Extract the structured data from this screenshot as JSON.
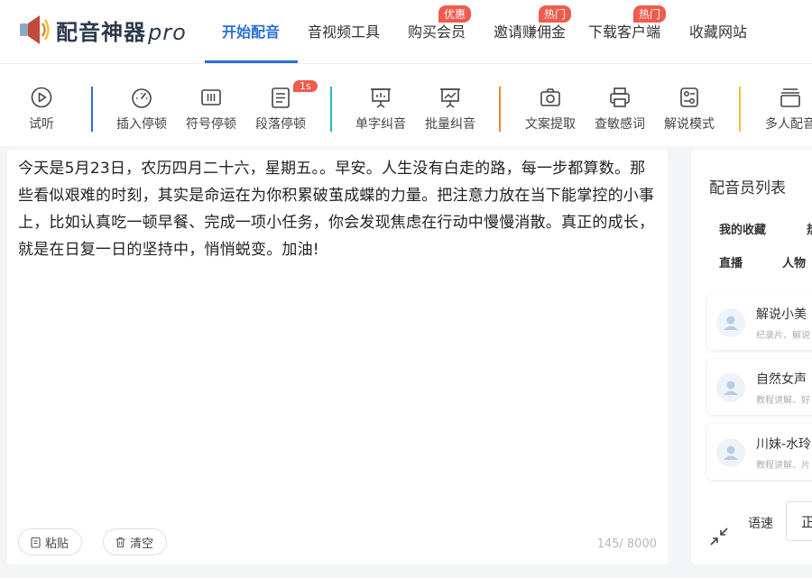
{
  "app": {
    "name": "配音神器",
    "name_suffix": "pro"
  },
  "nav": {
    "items": [
      {
        "label": "开始配音",
        "badge": ""
      },
      {
        "label": "音视频工具",
        "badge": ""
      },
      {
        "label": "购买会员",
        "badge": "优惠"
      },
      {
        "label": "邀请赚佣金",
        "badge": "热门"
      },
      {
        "label": "下载客户端",
        "badge": "热门"
      },
      {
        "label": "收藏网站",
        "badge": ""
      }
    ]
  },
  "toolbar": {
    "items": [
      {
        "label": "试听",
        "icon": "play-icon"
      },
      {
        "label": "插入停顿",
        "icon": "timer-icon"
      },
      {
        "label": "符号停顿",
        "icon": "symbol-pause-icon"
      },
      {
        "label": "段落停顿",
        "icon": "paragraph-pause-icon",
        "badge": "1s"
      },
      {
        "label": "单字纠音",
        "icon": "single-correct-icon"
      },
      {
        "label": "批量纠音",
        "icon": "batch-correct-icon"
      },
      {
        "label": "文案提取",
        "icon": "camera-icon"
      },
      {
        "label": "查敏感词",
        "icon": "printer-icon"
      },
      {
        "label": "解说模式",
        "icon": "settings-panel-icon"
      },
      {
        "label": "多人配音",
        "icon": "multi-voice-icon"
      }
    ],
    "separator_colors": [
      "#2a6fd6",
      "#22b5c9",
      "#f08a24",
      "#f2c230"
    ]
  },
  "editor": {
    "text": "今天是5月23日，农历四月二十六，星期五。。早安。人生没有白走的路，每一步都算数。那些看似艰难的时刻，其实是命运在为你积累破茧成蝶的力量。把注意力放在当下能掌控的小事上，比如认真吃一顿早餐、完成一项小任务，你会发现焦虑在行动中慢慢消散。真正的成长，就是在日复一日的坚持中，悄悄蜕变。加油!",
    "paste_label": "粘贴",
    "clear_label": "清空",
    "char_count": "145/ 8000"
  },
  "voice_panel": {
    "title": "配音员列表",
    "categories": [
      "我的收藏",
      "热",
      "直播",
      "人物"
    ],
    "voices": [
      {
        "name": "解说小美",
        "tags": "纪录片、解说"
      },
      {
        "name": "自然女声",
        "tags": "教程讲解、好"
      },
      {
        "name": "川妹-水玲",
        "tags": "教程讲解、片"
      }
    ],
    "speed_label": "语速",
    "speed_value": "正"
  },
  "colors": {
    "accent": "#2a6fd6",
    "badge": "#ef5b4c"
  }
}
